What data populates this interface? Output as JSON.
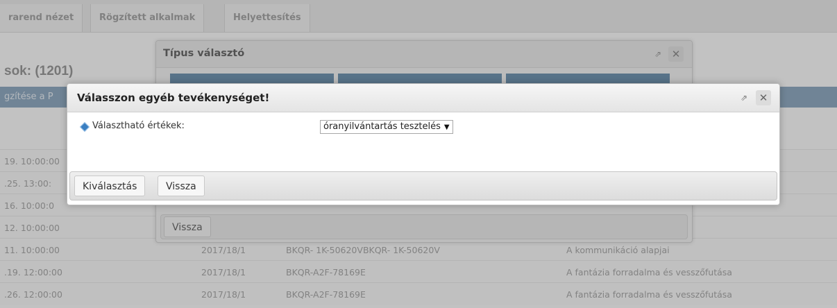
{
  "background": {
    "tabs": [
      "rarend nézet",
      "Rögzített alkalmak",
      "Helyettesítés"
    ],
    "list_title": "sok: (1201)",
    "action_text": "gzítése a P",
    "rows": [
      {
        "date": "19. 10:00:00",
        "term": "",
        "code": "",
        "course": ""
      },
      {
        "date": ".25. 13:00:",
        "term": "",
        "code": "",
        "course": ""
      },
      {
        "date": "16. 10:00:0",
        "term": "",
        "code": "",
        "course": ""
      },
      {
        "date": "12. 10:00:00",
        "term": "",
        "code": "",
        "course": ""
      },
      {
        "date": "11. 10:00:00",
        "term": "2017/18/1",
        "code": "BKQR- 1K-50620VBKQR- 1K-50620V",
        "course": "A kommunikáció alapjai"
      },
      {
        "date": ".19. 12:00:00",
        "term": "2017/18/1",
        "code": "BKQR-A2F-78169E",
        "course": "A fantázia forradalma és vesszőfutása"
      },
      {
        "date": ".26. 12:00:00",
        "term": "2017/18/1",
        "code": "BKQR-A2F-78169E",
        "course": "A fantázia forradalma és vesszőfutása"
      }
    ]
  },
  "type_dialog": {
    "title": "Típus választó",
    "back_label": "Vissza"
  },
  "active_dialog": {
    "title": "Válasszon egyéb tevékenységet!",
    "field_label": "Választható értékek:",
    "selected_value": "óranyilvántartás tesztelés",
    "select_button_label": "Kiválasztás",
    "back_button_label": "Vissza"
  },
  "icons": {
    "popout": "popout-icon",
    "close": "close-icon",
    "field_marker": "diamond-icon",
    "dropdown": "chevron-down-icon"
  },
  "colors": {
    "action_strip": "#6a8eb0",
    "tile_blue": "#3e6f98",
    "field_marker": "#3a7fc1"
  }
}
